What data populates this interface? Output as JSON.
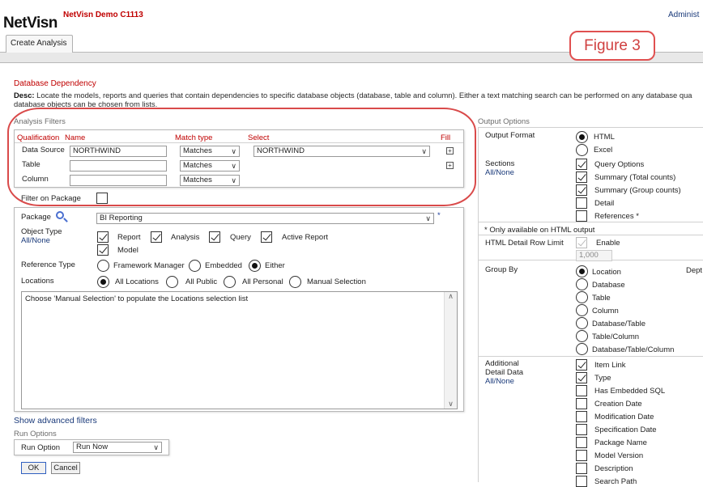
{
  "header": {
    "logo": "NetVisn",
    "app_title": "NetVisn Demo C1113",
    "admin_label": "Administ",
    "tab_label": "Create Analysis",
    "figure_label": "Figure 3"
  },
  "section": {
    "title": "Database Dependency",
    "desc_bold": "Desc:",
    "desc_line1": " Locate the models, reports and queries that contain dependencies to specific database objects (database, table and column). Either a text matching search can be performed on any database qua",
    "desc_line2": "database objects can be chosen from lists."
  },
  "filters": {
    "group_label": "Analysis Filters",
    "headers": {
      "qualification": "Qualification",
      "name": "Name",
      "match_type": "Match type",
      "select": "Select",
      "fill": "Fill"
    },
    "rows": [
      {
        "label": "Data Source",
        "name": "NORTHWIND",
        "match": "Matches",
        "select": "NORTHWIND"
      },
      {
        "label": "Table",
        "name": "",
        "match": "Matches"
      },
      {
        "label": "Column",
        "name": "",
        "match": "Matches"
      }
    ],
    "filter_on_package": "Filter on Package",
    "package_label": "Package",
    "package_value": "BI Reporting",
    "required_mark": "*",
    "object_type_label": "Object Type",
    "all_none": "All/None",
    "object_types": [
      "Report",
      "Analysis",
      "Query",
      "Active Report",
      "Model"
    ],
    "reference_type_label": "Reference Type",
    "reference_types": [
      "Framework Manager",
      "Embedded",
      "Either"
    ],
    "locations_label": "Locations",
    "locations": [
      "All Locations",
      "All Public",
      "All Personal",
      "Manual Selection"
    ],
    "locations_hint": "Choose 'Manual Selection' to populate the Locations selection list",
    "advanced_link": "Show advanced filters"
  },
  "run_options": {
    "group_label": "Run Options",
    "label": "Run Option",
    "value": "Run Now",
    "ok": "OK",
    "cancel": "Cancel"
  },
  "output": {
    "group_label": "Output Options",
    "format_label": "Output Format",
    "formats": [
      "HTML",
      "Excel"
    ],
    "sections_label": "Sections",
    "all_none": "All/None",
    "sections": [
      "Query Options",
      "Summary (Total counts)",
      "Summary (Group counts)",
      "Detail",
      "References *"
    ],
    "html_note": "* Only available on HTML output",
    "row_limit_label": "HTML Detail Row Limit",
    "enable_label": "Enable",
    "row_limit_value": "1,000",
    "group_by_label": "Group By",
    "group_by": [
      "Location",
      "Database",
      "Table",
      "Column",
      "Database/Table",
      "Table/Column",
      "Database/Table/Column"
    ],
    "group_by_extra": "Dept",
    "additional_label1": "Additional",
    "additional_label2": "Detail Data",
    "additional": [
      "Item Link",
      "Type",
      "Has Embedded SQL",
      "Creation Date",
      "Modification Date",
      "Specification Date",
      "Package Name",
      "Model Version",
      "Description",
      "Search Path"
    ]
  }
}
